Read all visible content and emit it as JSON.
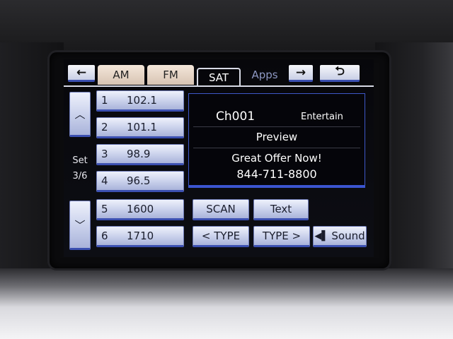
{
  "tabs": [
    {
      "label": "AM"
    },
    {
      "label": "FM"
    },
    {
      "label": "SAT"
    },
    {
      "label": "Apps"
    }
  ],
  "nav": {
    "back": "←",
    "forward": "→",
    "return": "⮌"
  },
  "set": {
    "label": "Set",
    "page": "3/6"
  },
  "presets": [
    {
      "num": "1",
      "freq": "102.1"
    },
    {
      "num": "2",
      "freq": "101.1"
    },
    {
      "num": "3",
      "freq": "98.9"
    },
    {
      "num": "4",
      "freq": "96.5"
    },
    {
      "num": "5",
      "freq": "1600"
    },
    {
      "num": "6",
      "freq": "1710"
    }
  ],
  "info": {
    "channel": "Ch001",
    "category": "Entertain",
    "name": "Preview",
    "line1": "Great Offer Now!",
    "line2": "844-711-8800"
  },
  "controls": {
    "scan": "SCAN",
    "text": "Text",
    "type_prev": "< TYPE",
    "type_next": "TYPE >",
    "sound": "Sound"
  },
  "colors": {
    "accent": "#3b55d0",
    "button_face": "#cfd6ee",
    "tab_face": "#d8c4b3"
  }
}
